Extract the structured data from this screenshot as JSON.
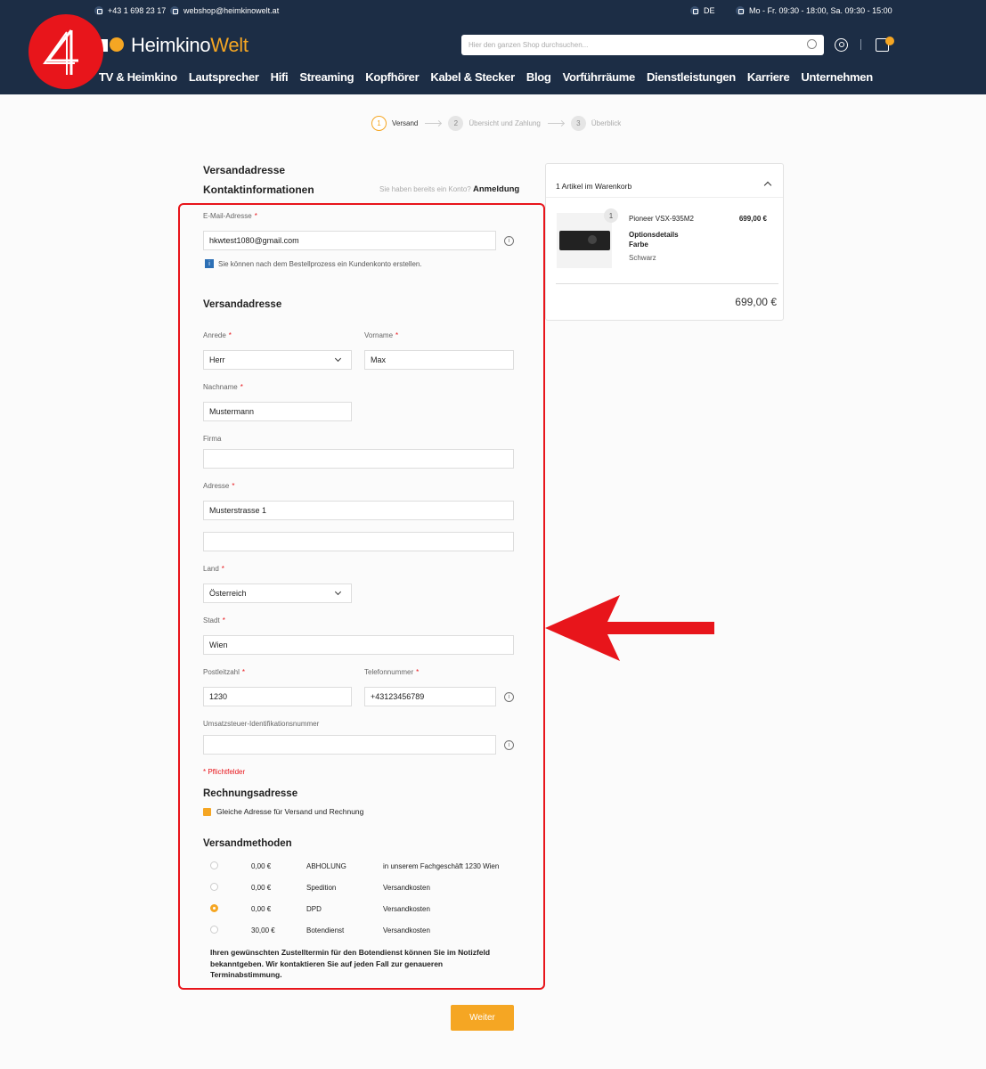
{
  "topbar": {
    "phone": "+43 1 698 23 17",
    "email": "webshop@heimkinowelt.at",
    "language": "DE",
    "hours": "Mo - Fr. 09:30 - 18:00, Sa. 09:30 - 15:00"
  },
  "header": {
    "brand_part1": "Heimkino",
    "brand_part2": "Welt",
    "search_placeholder": "Hier den ganzen Shop durchsuchen...",
    "nav": [
      "TV & Heimkino",
      "Lautsprecher",
      "Hifi",
      "Streaming",
      "Kopfhörer",
      "Kabel & Stecker",
      "Blog",
      "Vorführräume",
      "Dienstleistungen",
      "Karriere",
      "Unternehmen"
    ]
  },
  "steps": [
    {
      "num": "1",
      "label": "Versand"
    },
    {
      "num": "2",
      "label": "Übersicht und Zahlung"
    },
    {
      "num": "3",
      "label": "Überblick"
    }
  ],
  "form": {
    "title": "Versandadresse",
    "contact_title": "Kontaktinformationen",
    "login_hint": "Sie haben bereits ein Konto?",
    "login_link": "Anmeldung",
    "email_label": "E-Mail-Adresse",
    "email_value": "hkwtest1080@gmail.com",
    "account_note": "Sie können nach dem Bestellprozess ein Kundenkonto erstellen.",
    "shipping_title": "Versandadresse",
    "salutation_label": "Anrede",
    "salutation_value": "Herr",
    "firstname_label": "Vorname",
    "firstname_value": "Max",
    "lastname_label": "Nachname",
    "lastname_value": "Mustermann",
    "company_label": "Firma",
    "company_value": "",
    "address_label": "Adresse",
    "address_value": "Musterstrasse 1",
    "address2_value": "",
    "country_label": "Land",
    "country_value": "Österreich",
    "city_label": "Stadt",
    "city_value": "Wien",
    "zip_label": "Postleitzahl",
    "zip_value": "1230",
    "phone_label": "Telefonnummer",
    "phone_value": "+43123456789",
    "vat_label": "Umsatzsteuer-Identifikationsnummer",
    "vat_value": "",
    "required_note": "* Pflichtfelder",
    "billing_title": "Rechnungsadresse",
    "same_address_label": "Gleiche Adresse für Versand und Rechnung",
    "shipping_methods_title": "Versandmethoden",
    "shipping_methods": [
      {
        "price": "0,00 €",
        "name": "ABHOLUNG",
        "desc": "in unserem Fachgeschäft 1230 Wien",
        "selected": false
      },
      {
        "price": "0,00 €",
        "name": "Spedition",
        "desc": "Versandkosten",
        "selected": false
      },
      {
        "price": "0,00 €",
        "name": "DPD",
        "desc": "Versandkosten",
        "selected": true
      },
      {
        "price": "30,00 €",
        "name": "Botendienst",
        "desc": "Versandkosten",
        "selected": false
      }
    ],
    "shipping_note": "Ihren gewünschten Zustelltermin für den Botendienst können Sie im Notizfeld bekanntgeben. Wir kontaktieren Sie auf jeden Fall zur genaueren Terminabstimmung.",
    "submit_label": "Weiter"
  },
  "cart": {
    "header": "1 Artikel im Warenkorb",
    "qty": "1",
    "product_name": "Pioneer VSX-935M2",
    "product_price": "699,00 €",
    "options_label": "Optionsdetails",
    "color_label": "Farbe",
    "color_value": "Schwarz",
    "total": "699,00 €"
  },
  "colors": {
    "header_bg": "#1c2d45",
    "accent": "#f5a623",
    "highlight_red": "#e8151b"
  }
}
